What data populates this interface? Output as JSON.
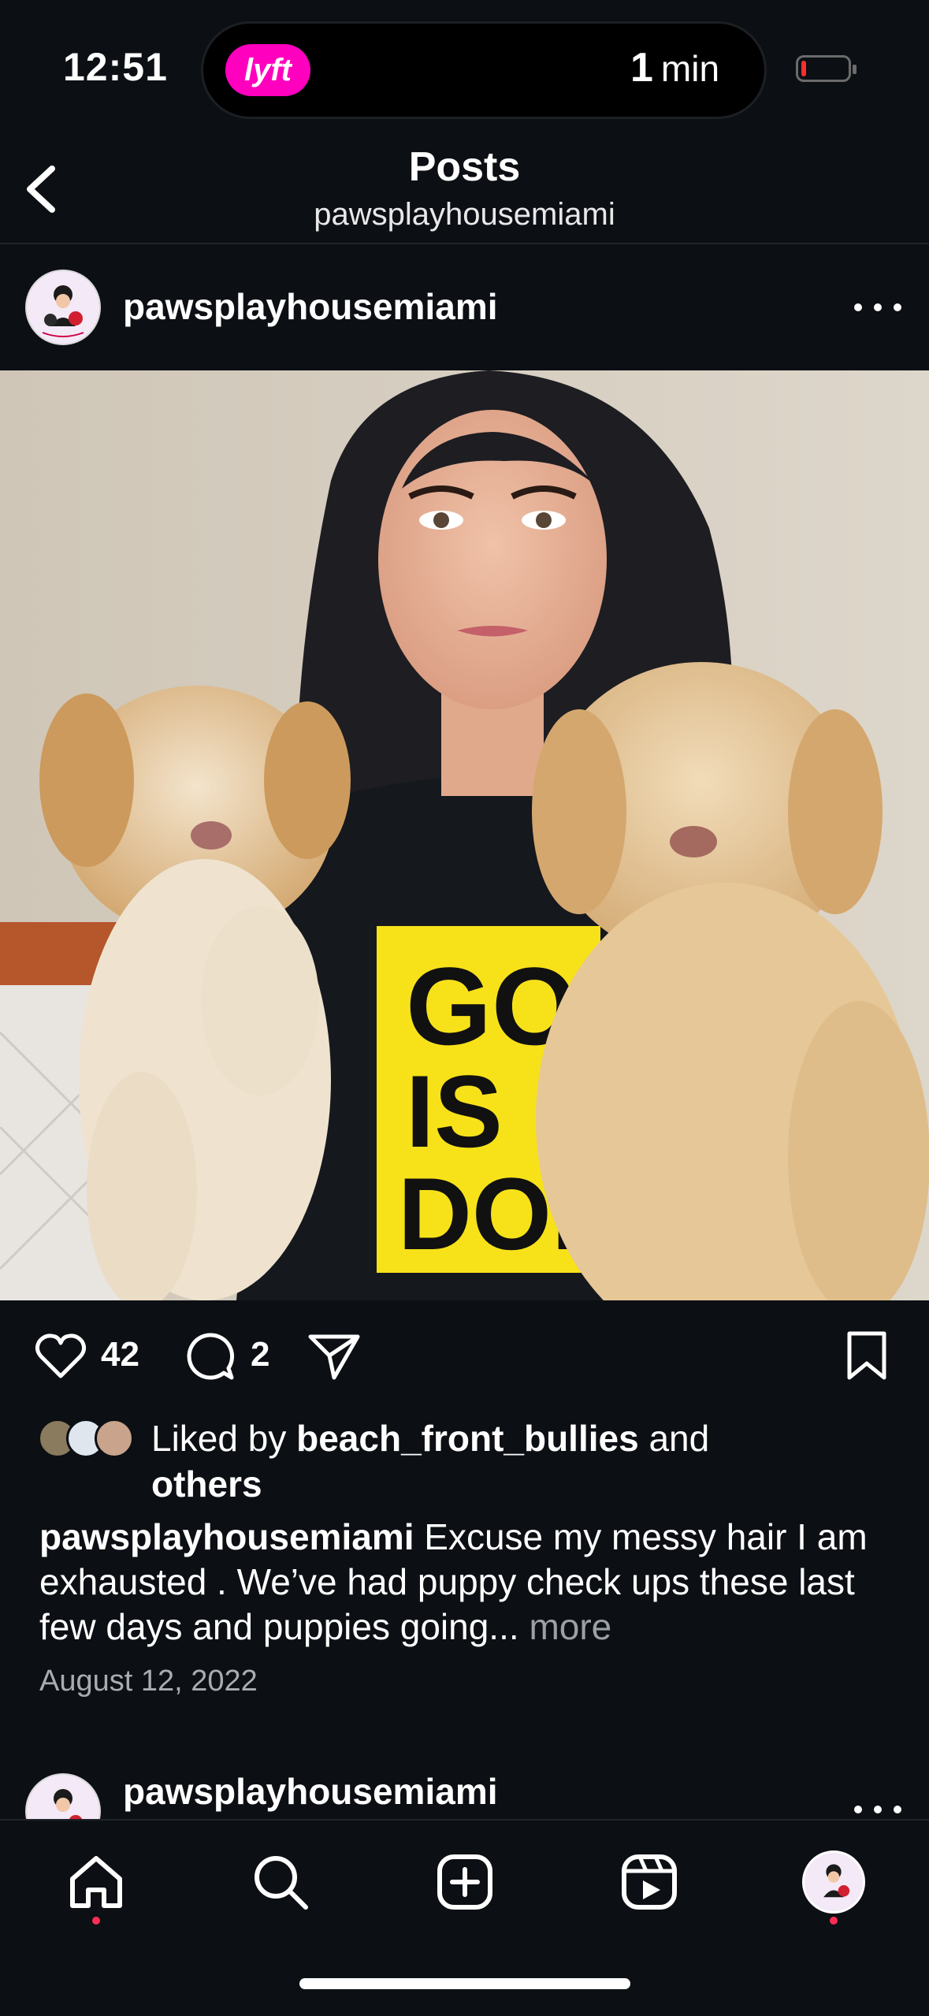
{
  "status_bar": {
    "time": "12:51",
    "live_activity_app": "lyft",
    "eta_value": "1",
    "eta_unit": "min",
    "battery_level": 0.1
  },
  "header": {
    "title": "Posts",
    "subtitle": "pawsplayhousemiami"
  },
  "post": {
    "username": "pawsplayhousemiami",
    "shirt_text": [
      "GOD",
      "IS",
      "DOPE."
    ],
    "likes_count": "42",
    "comments_count": "2",
    "liked_by_prefix": "Liked by",
    "liked_by_user": "beach_front_bullies",
    "liked_by_and": "and",
    "liked_by_others": "others",
    "caption_username": "pawsplayhousemiami",
    "caption_text": "Excuse my messy hair I am exhausted . We’ve had puppy check ups these last few days and puppies going...",
    "caption_more": "more",
    "date": "August 12, 2022"
  },
  "next_post": {
    "username": "pawsplayhousemiami"
  },
  "colors": {
    "background": "#0c0f14",
    "lyft_pink": "#ff00bf",
    "notification_dot": "#ff2d55",
    "secondary_text": "#a8adb3"
  },
  "nav_icons": [
    "home-icon",
    "search-icon",
    "create-icon",
    "reels-icon",
    "profile-avatar"
  ]
}
